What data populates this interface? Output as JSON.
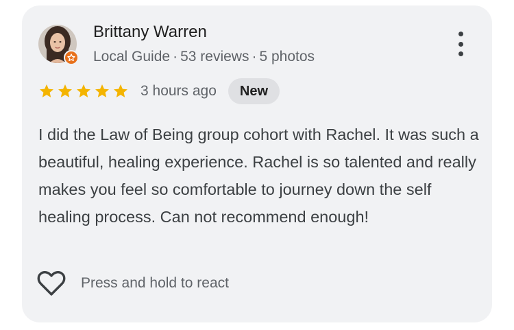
{
  "review": {
    "author_name": "Brittany Warren",
    "author_badge": "Local Guide",
    "review_count": "53 reviews",
    "photo_count": "5 photos",
    "separator": "·",
    "rating": 5,
    "max_rating": 5,
    "time_ago": "3 hours ago",
    "new_label": "New",
    "text": "I did the Law of Being group cohort with Rachel. It was such a beautiful, healing experience. Rachel is so talented and really makes you feel so comfortable to journey down the self healing process. Can not recommend enough!",
    "react_label": "Press and hold to react"
  },
  "icons": {
    "menu": "more-vert-icon",
    "react": "heart-outline-icon",
    "badge": "local-guide-star-icon",
    "star": "star-filled-icon"
  },
  "colors": {
    "card_bg": "#f1f2f4",
    "star": "#f4b400",
    "badge": "#e8711c",
    "new_badge_bg": "#dfe0e3"
  }
}
